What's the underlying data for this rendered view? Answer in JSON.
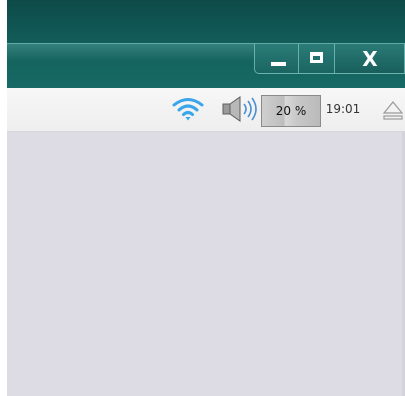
{
  "titlebar": {
    "buttons": {
      "minimize": "minimize",
      "maximize": "maximize",
      "close_label": "X"
    },
    "color": "#115a57"
  },
  "tray": {
    "wifi_icon": "wifi-icon",
    "volume_icon": "volume-icon",
    "battery": {
      "label": "20 %",
      "percent": 20
    },
    "clock": "19:01",
    "eject_icon": "eject-icon"
  },
  "desktop": {
    "color": "#dddbe4"
  }
}
